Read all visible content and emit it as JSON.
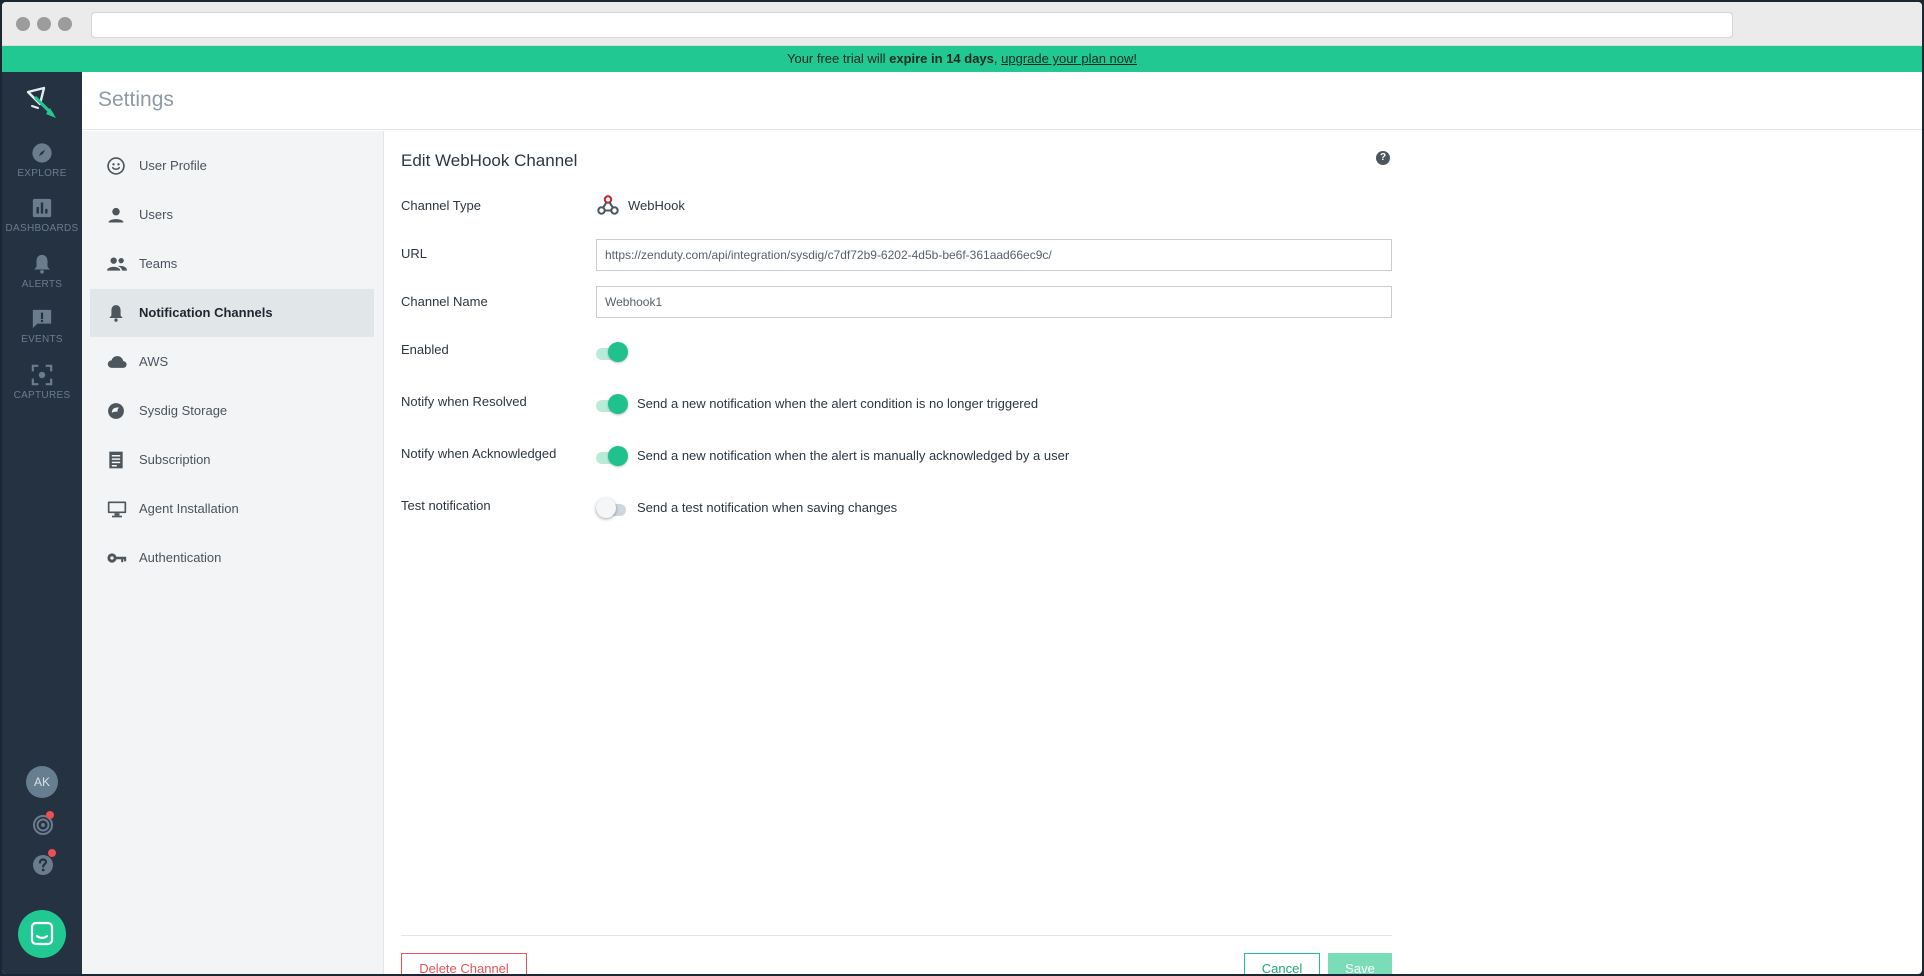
{
  "trial_banner": {
    "prefix": "Your free trial will ",
    "emphasis": "expire in 14 days",
    "separator": ",",
    "link": "upgrade your plan now!"
  },
  "rail": {
    "items": [
      {
        "label": "EXPLORE",
        "icon": "compass-icon"
      },
      {
        "label": "DASHBOARDS",
        "icon": "bar-chart-icon"
      },
      {
        "label": "ALERTS",
        "icon": "bell-icon"
      },
      {
        "label": "EVENTS",
        "icon": "alert-message-icon"
      },
      {
        "label": "CAPTURES",
        "icon": "capture-frame-icon"
      }
    ],
    "avatar_initials": "AK"
  },
  "page_title": "Settings",
  "settings_nav": {
    "items": [
      {
        "label": "User Profile",
        "icon": "smiley-icon"
      },
      {
        "label": "Users",
        "icon": "person-icon"
      },
      {
        "label": "Teams",
        "icon": "people-icon"
      },
      {
        "label": "Notification Channels",
        "icon": "bell-icon",
        "active": true
      },
      {
        "label": "AWS",
        "icon": "cloud-icon"
      },
      {
        "label": "Sysdig Storage",
        "icon": "storage-icon"
      },
      {
        "label": "Subscription",
        "icon": "receipt-icon"
      },
      {
        "label": "Agent Installation",
        "icon": "monitor-icon"
      },
      {
        "label": "Authentication",
        "icon": "key-icon"
      }
    ]
  },
  "form": {
    "title": "Edit WebHook Channel",
    "help_glyph": "?",
    "channel_type_label": "Channel Type",
    "channel_type_value": "WebHook",
    "url_label": "URL",
    "url_value": "https://zenduty.com/api/integration/sysdig/c7df72b9-6202-4d5b-be6f-361aad66ec9c/",
    "channel_name_label": "Channel Name",
    "channel_name_value": "Webhook1",
    "enabled_label": "Enabled",
    "enabled": true,
    "notify_resolved_label": "Notify when Resolved",
    "notify_resolved": true,
    "notify_resolved_desc": "Send a new notification when the alert condition is no longer triggered",
    "notify_ack_label": "Notify when Acknowledged",
    "notify_ack": true,
    "notify_ack_desc": "Send a new notification when the alert is manually acknowledged by a user",
    "test_label": "Test notification",
    "test": false,
    "test_desc": "Send a test notification when saving changes"
  },
  "actions": {
    "delete_label": "Delete Channel",
    "cancel_label": "Cancel",
    "save_label": "Save"
  },
  "colors": {
    "accent": "#22c891",
    "rail_bg": "#243241",
    "danger": "#e4545b"
  }
}
